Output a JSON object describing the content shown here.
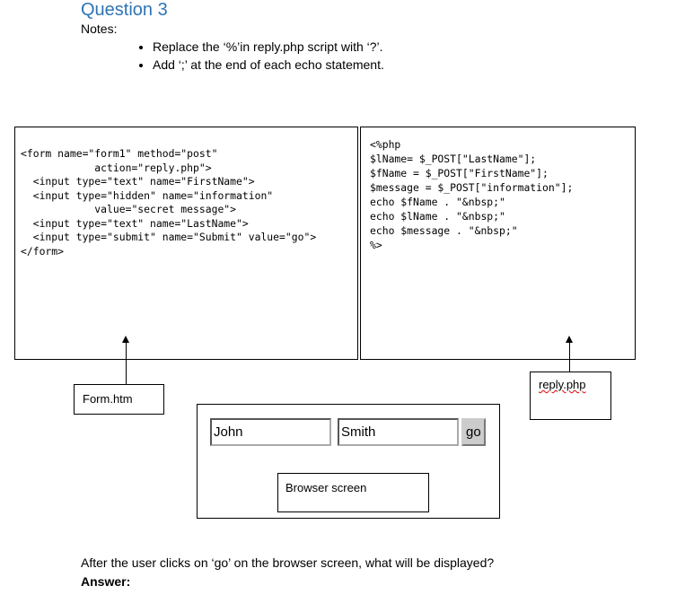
{
  "title": "Question 3",
  "notes_label": "Notes:",
  "notes": [
    "Replace the ‘%’in reply.php script with ‘?’.",
    "Add ‘;’ at the end of each echo statement."
  ],
  "form_code": [
    "<form name=\"form1\" method=\"post\"",
    "            action=\"reply.php\">",
    "  <input type=\"text\" name=\"FirstName\">",
    "  <input type=\"hidden\" name=\"information\"",
    "            value=\"secret message\">",
    "  <input type=\"text\" name=\"LastName\">",
    "  <input type=\"submit\" name=\"Submit\" value=\"go\">",
    "</form>"
  ],
  "php_code": [
    "<%php",
    "$lName= $_POST[\"LastName\"];",
    "$fName = $_POST[\"FirstName\"];",
    "$message = $_POST[\"information\"];",
    "echo $fName . \"&nbsp;\"",
    "echo $lName . \"&nbsp;\"",
    "echo $message . \"&nbsp;\"",
    "%>"
  ],
  "form_label": "Form.htm",
  "php_label": "reply.php",
  "browser": {
    "first_name": "John",
    "last_name": "Smith",
    "button": "go",
    "label": "Browser screen"
  },
  "question": "After the user clicks on ‘go’ on the browser screen, what will be displayed?",
  "answer_label": "Answer:"
}
